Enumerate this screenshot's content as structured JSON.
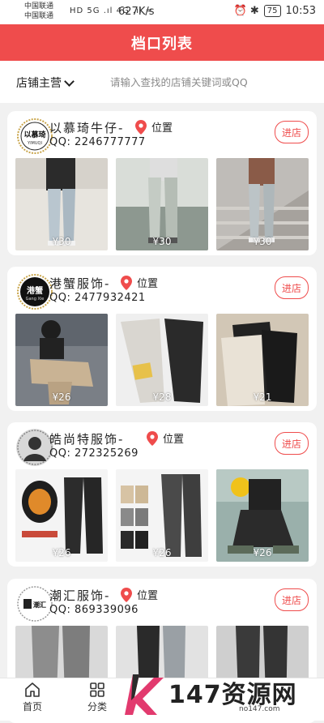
{
  "status_bar": {
    "carrier_1": "中国联通",
    "carrier_2": "中国联通",
    "network_icons": "HD 5G .ıl 4G .ıl ≈",
    "speed": "627K/s",
    "right_icons": "⏰ ✱",
    "battery": "75",
    "time": "10:53"
  },
  "header": {
    "title": "档口列表"
  },
  "filter": {
    "dropdown_label": "店铺主营",
    "search_placeholder": "请输入查找的店铺关键词或QQ"
  },
  "shops": [
    {
      "avatar_text": "以慕琦",
      "avatar_sub": "YIMUQI",
      "name": "以慕琦牛仔-",
      "location_label": "位置",
      "qq": "QQ: 2246777777",
      "enter_label": "进店",
      "products": [
        {
          "price": "¥30"
        },
        {
          "price": "¥30"
        },
        {
          "price": "¥30"
        }
      ]
    },
    {
      "avatar_text": "港蟹",
      "avatar_sub": "Gang Xie",
      "name": "港蟹服饰-",
      "location_label": "位置",
      "qq": "QQ: 2477932421",
      "enter_label": "进店",
      "products": [
        {
          "price": "¥26"
        },
        {
          "price": "¥28"
        },
        {
          "price": "¥21"
        }
      ]
    },
    {
      "avatar_text": "",
      "avatar_sub": "",
      "name": "皓尚特服饰-",
      "location_label": "位置",
      "qq": "QQ: 272325269",
      "enter_label": "进店",
      "products": [
        {
          "price": "¥26"
        },
        {
          "price": "¥26"
        },
        {
          "price": "¥26"
        }
      ]
    },
    {
      "avatar_text": "潮汇",
      "avatar_sub": "",
      "name": "潮汇服饰-",
      "location_label": "位置",
      "qq": "QQ: 869339096",
      "enter_label": "进店",
      "products": [
        {
          "price": ""
        },
        {
          "price": ""
        },
        {
          "price": ""
        }
      ]
    }
  ],
  "bottom_nav": {
    "home_label": "首页",
    "category_label": "分类"
  },
  "watermark": {
    "text": "147资源网",
    "url": "no147.com"
  },
  "colors": {
    "accent": "#ef4c4c",
    "background": "#f1f1f1"
  }
}
